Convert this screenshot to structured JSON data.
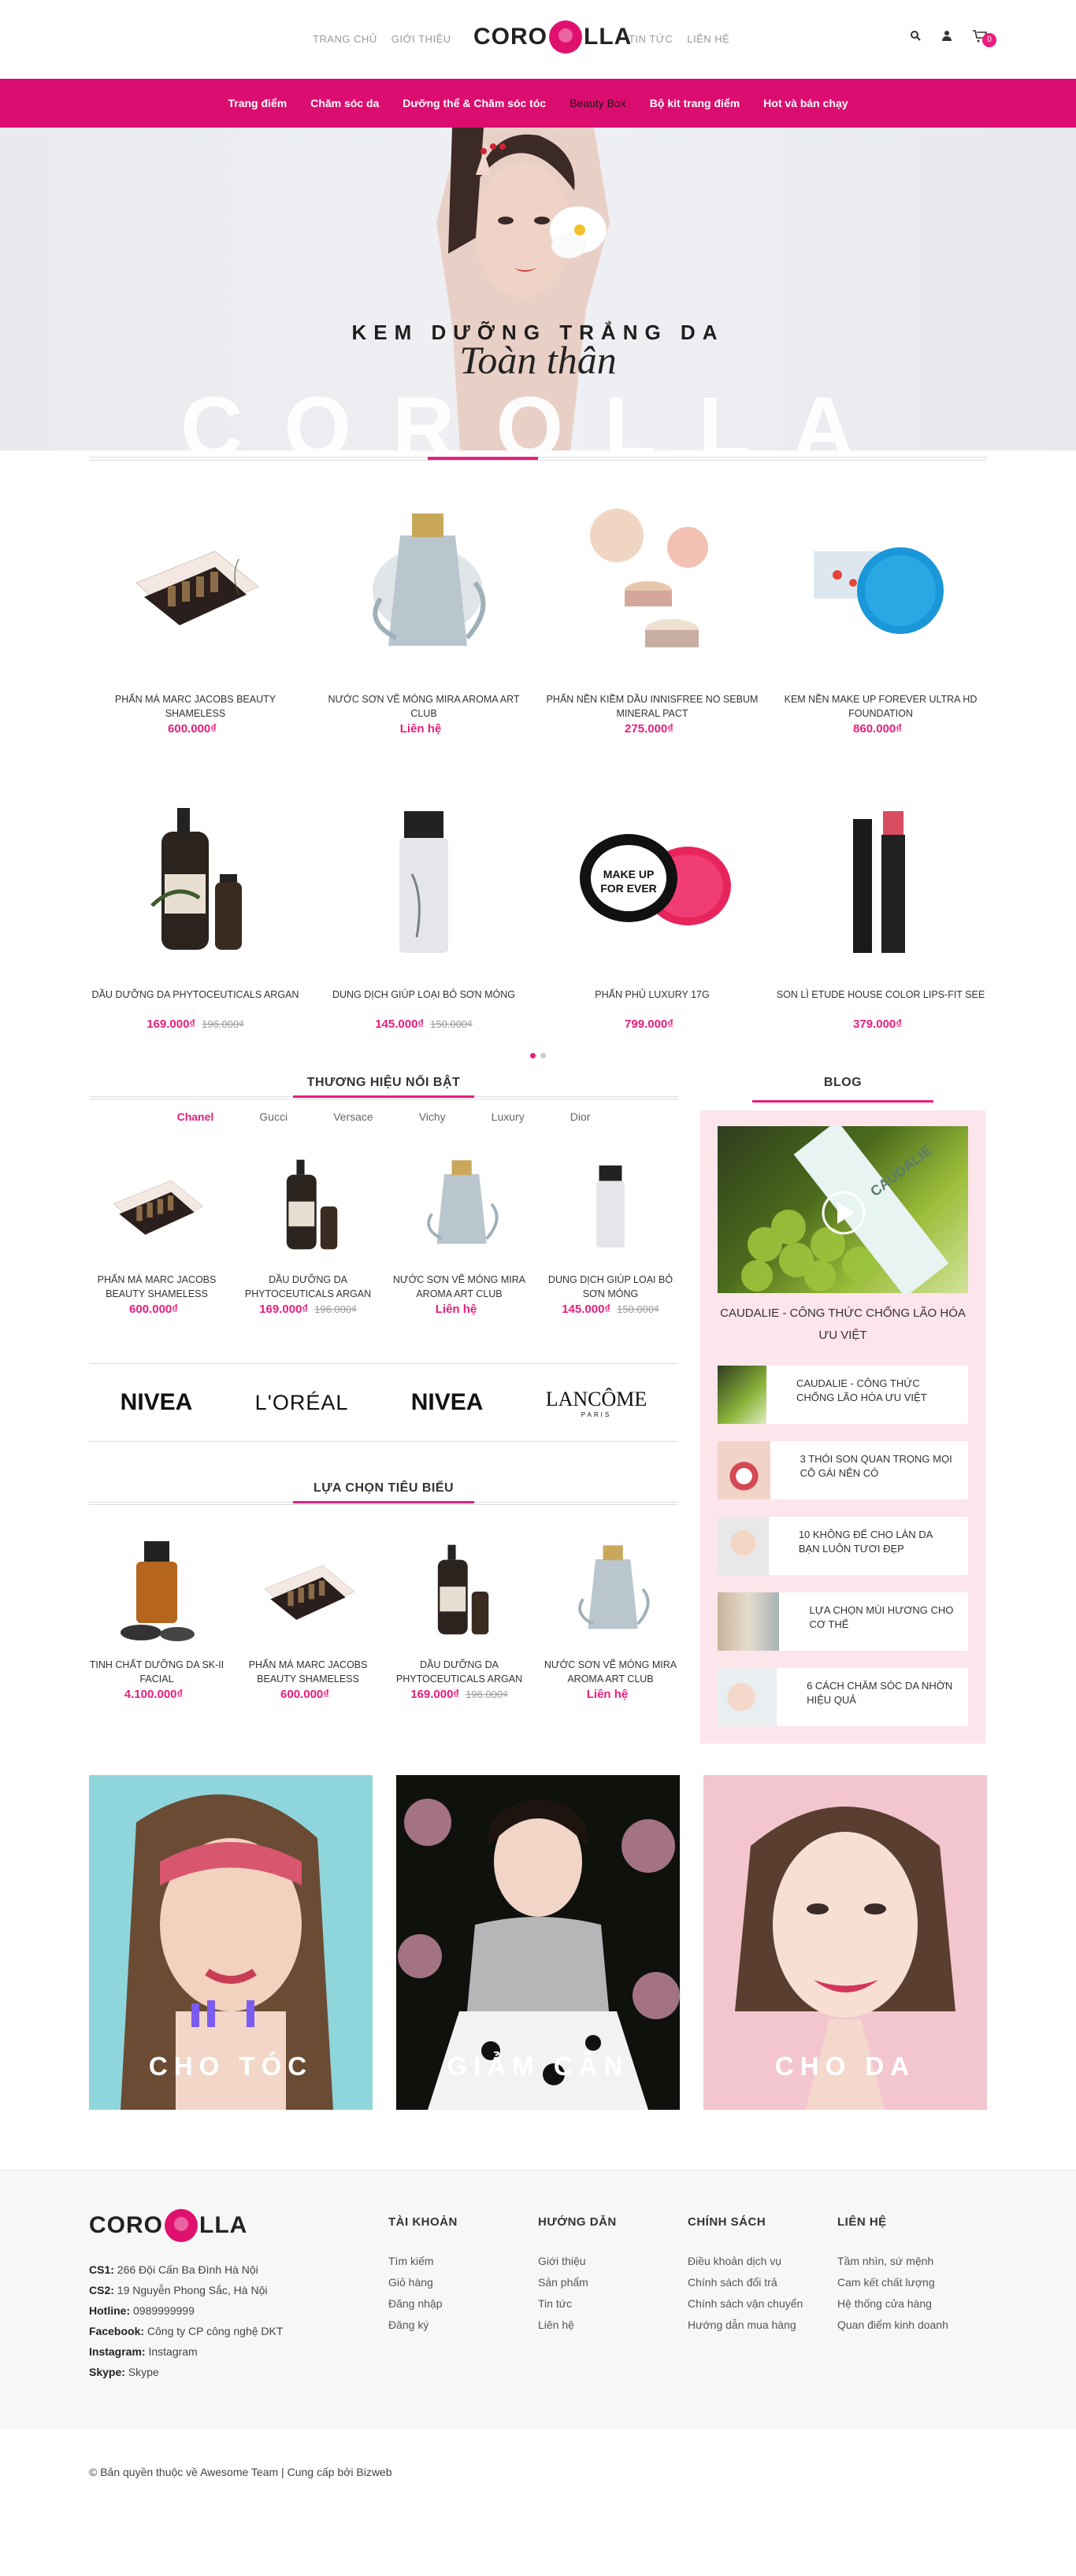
{
  "header": {
    "left_nav": [
      "TRANG CHỦ",
      "GIỚI THIỆU"
    ],
    "logo_left": "CORO",
    "logo_right": "LLA",
    "right_nav": [
      "TIN TỨC",
      "LIÊN HỆ"
    ],
    "cart_count": "0"
  },
  "menu": [
    "Trang điểm",
    "Chăm sóc da",
    "Dưỡng thể & Chăm sóc tóc",
    "Beauty Box",
    "Bộ kit trang điểm",
    "Hot và bán chạy"
  ],
  "hero": {
    "line1": "KEM DƯỠNG TRẮNG DA",
    "line2": "Toàn thân",
    "line3": "COROLLA"
  },
  "products": [
    {
      "name": "PHẤN MÁ MARC JACOBS BEAUTY SHAMELESS",
      "price": "600.000₫",
      "old": ""
    },
    {
      "name": "NƯỚC SƠN VẼ MÓNG MIRA AROMA ART CLUB",
      "price": "Liên hệ",
      "old": ""
    },
    {
      "name": "PHẤN NỀN KIỀM DẦU INNISFREE NO SEBUM MINERAL PACT",
      "price": "275.000₫",
      "old": ""
    },
    {
      "name": "KEM NỀN MAKE UP FOREVER ULTRA HD FOUNDATION",
      "price": "860.000₫",
      "old": ""
    },
    {
      "name": "DẦU DƯỠNG DA PHYTOCEUTICALS ARGAN",
      "price": "169.000₫",
      "old": "196.000₫"
    },
    {
      "name": "DUNG DỊCH GIÚP LOẠI BỎ SƠN MÓNG",
      "price": "145.000₫",
      "old": "150.000₫"
    },
    {
      "name": "PHẤN PHỦ LUXURY 17G",
      "price": "799.000₫",
      "old": ""
    },
    {
      "name": "SON LÌ ETUDE HOUSE COLOR LIPS-FIT SEE",
      "price": "379.000₫",
      "old": ""
    }
  ],
  "brands_section": {
    "title": "THƯƠNG HIỆU NỔI BẬT",
    "tabs": [
      "Chanel",
      "Gucci",
      "Versace",
      "Vichy",
      "Luxury",
      "Dior"
    ],
    "items": [
      {
        "name": "PHẤN MÁ MARC JACOBS BEAUTY SHAMELESS",
        "price": "600.000₫",
        "old": ""
      },
      {
        "name": "DẦU DƯỠNG DA PHYTOCEUTICALS ARGAN",
        "price": "169.000₫",
        "old": "196.000₫"
      },
      {
        "name": "NƯỚC SƠN VẼ MÓNG MIRA AROMA ART CLUB",
        "price": "Liên hệ",
        "old": ""
      },
      {
        "name": "DUNG DỊCH GIÚP LOẠI BỎ SƠN MÓNG",
        "price": "145.000₫",
        "old": "150.000₫"
      }
    ],
    "logos": [
      "NIVEA",
      "L'ORÉAL",
      "NIVEA",
      "LANCÔME"
    ],
    "logo_sub": "PARIS"
  },
  "picks": {
    "title": "LỰA CHỌN TIÊU BIỂU",
    "items": [
      {
        "name": "TINH CHẤT DƯỠNG DA SK-II FACIAL",
        "price": "4.100.000₫",
        "old": ""
      },
      {
        "name": "PHẤN MÁ MARC JACOBS BEAUTY SHAMELESS",
        "price": "600.000₫",
        "old": ""
      },
      {
        "name": "DẦU DƯỠNG DA PHYTOCEUTICALS ARGAN",
        "price": "169.000₫",
        "old": "196.000₫"
      },
      {
        "name": "NƯỚC SƠN VẼ MÓNG MIRA AROMA ART CLUB",
        "price": "Liên hệ",
        "old": ""
      }
    ]
  },
  "blog": {
    "title": "BLOG",
    "feature_title": "CAUDALIE - CÔNG THỨC CHỐNG LÃO HÓA ƯU VIỆT",
    "feature_brand": "CAUDALIE",
    "items": [
      "CAUDALIE - CÔNG THỨC CHỐNG LÃO HÓA ƯU VIỆT",
      "3 THÓI SON QUAN TRỌNG MỌI CÔ GÁI NÊN CÓ",
      "10 KHÔNG ĐỂ CHO LÀN DA BẠN LUÔN TƯƠI ĐẸP",
      "LỰA CHỌN MÙI HƯƠNG CHO CƠ THỂ",
      "6 CÁCH CHĂM SÓC DA NHỜN HIỆU QUẢ"
    ]
  },
  "banners": [
    "CHO TÓC",
    "GIẢM CÂN",
    "CHO DA"
  ],
  "footer": {
    "info": [
      {
        "k": "CS1:",
        "v": " 266 Đội Cấn Ba Đình Hà Nội"
      },
      {
        "k": "CS2:",
        "v": " 19 Nguyễn Phong Sắc, Hà Nội"
      },
      {
        "k": "Hotline:",
        "v": " 0989999999"
      },
      {
        "k": "Facebook:",
        "v": " Công ty CP công nghệ DKT"
      },
      {
        "k": "Instagram:",
        "v": " Instagram"
      },
      {
        "k": "Skype:",
        "v": " Skype"
      }
    ],
    "cols": [
      {
        "title": "TÀI KHOẢN",
        "links": [
          "Tìm kiếm",
          "Giỏ hàng",
          "Đăng nhập",
          "Đăng ký"
        ]
      },
      {
        "title": "HƯỚNG DẪN",
        "links": [
          "Giới thiệu",
          "Sản phẩm",
          "Tin tức",
          "Liên hệ"
        ]
      },
      {
        "title": "CHÍNH SÁCH",
        "links": [
          "Điều khoản dịch vụ",
          "Chính sách đổi trả",
          "Chính sách vận chuyển",
          "Hướng dẫn mua hàng"
        ]
      },
      {
        "title": "LIÊN HỆ",
        "links": [
          "Tầm nhìn, sứ mệnh",
          "Cam kết chất lượng",
          "Hệ thống cửa hàng",
          "Quan điểm kinh doanh"
        ]
      }
    ],
    "copyright": "© Bản quyền thuộc về Awesome Team | Cung cấp bởi Bizweb"
  },
  "colors": {
    "accent": "#e91e7c",
    "menu_bg": "#dc0d70"
  }
}
